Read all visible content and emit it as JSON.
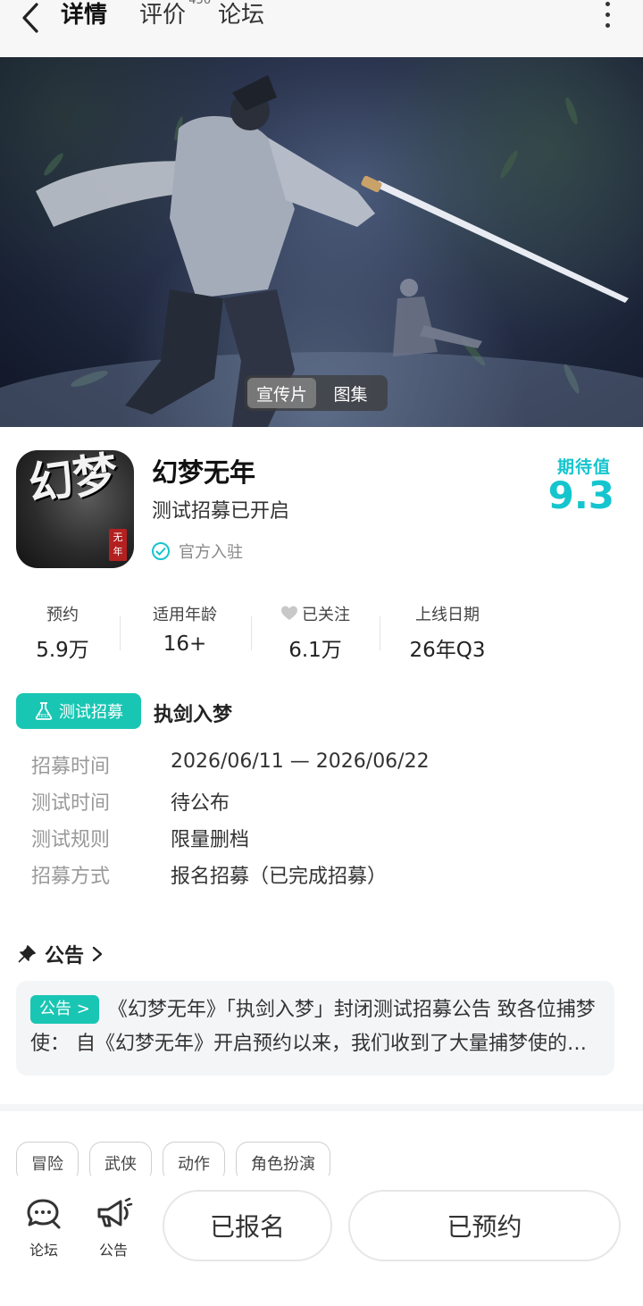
{
  "nav": {
    "back_icon": "back-arrow-icon",
    "tabs": [
      {
        "label": "详情",
        "active": true
      },
      {
        "label": "评价",
        "count": "456"
      },
      {
        "label": "论坛"
      }
    ],
    "more_icon": "more-vertical-icon"
  },
  "hero": {
    "switch": [
      "宣传片",
      "图集"
    ],
    "active_switch": "宣传片"
  },
  "app": {
    "title": "幻梦无年",
    "subtitle": "测试招募已开启",
    "official_label": "官方入驻",
    "icon_calligraphy": "幻梦",
    "icon_seal": "无年",
    "expect_label": "期待值",
    "expect_score": "9.3"
  },
  "stats": [
    {
      "label": "预约",
      "value": "5.9万"
    },
    {
      "label": "适用年龄",
      "value": "16+"
    },
    {
      "label": "已关注",
      "value": "6.1万",
      "icon": "heart-icon"
    },
    {
      "label": "上线日期",
      "value": "26年Q3"
    }
  ],
  "recruit": {
    "badge": "测试招募",
    "name": "执剑入梦",
    "rows": [
      {
        "key": "招募时间",
        "value": "2026/06/11 — 2026/06/22"
      },
      {
        "key": "测试时间",
        "value": "待公布"
      },
      {
        "key": "测试规则",
        "value": "限量删档"
      },
      {
        "key": "招募方式",
        "value": "报名招募（已完成招募）"
      }
    ]
  },
  "announcement": {
    "heading": "公告",
    "tag": "公告 >",
    "text": "《幻梦无年》「执剑入梦」封闭测试招募公告 致各位捕梦使： 自《幻梦无年》开启预约以来，我们收到了大量捕梦使的关注与支持"
  },
  "genres": [
    "冒险",
    "武侠",
    "动作",
    "角色扮演"
  ],
  "bottom": {
    "forum": "论坛",
    "notice": "公告",
    "signed_up": "已报名",
    "reserved": "已预约"
  },
  "colors": {
    "accent": "#15c5ce",
    "badge": "#19c6b3"
  }
}
